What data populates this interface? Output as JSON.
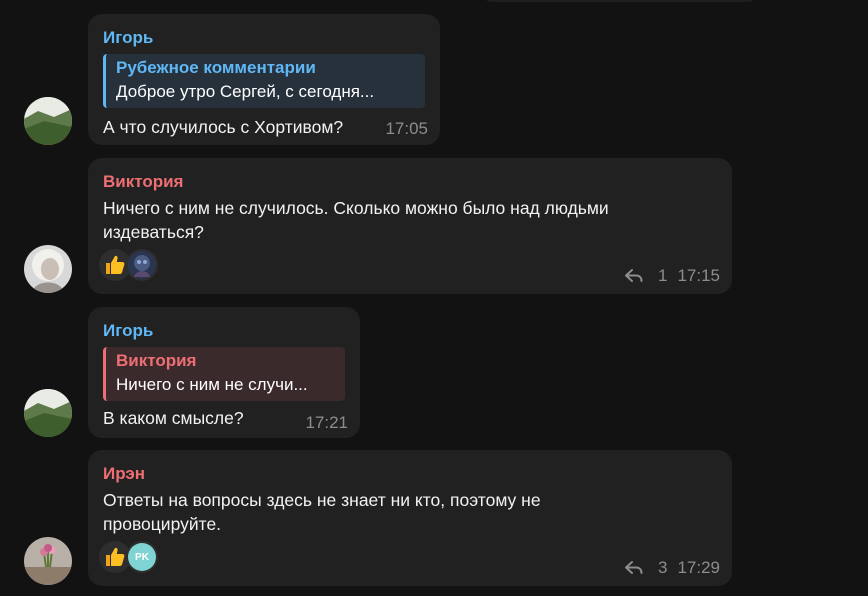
{
  "colors": {
    "background": "#121212",
    "bubble": "#212121",
    "name_blue": "#5fb8f5",
    "name_red": "#ee6f73",
    "meta": "#8d8d8d"
  },
  "messages": [
    {
      "sender": "Игорь",
      "reply": {
        "name": "Рубежное комментарии",
        "text": "Доброе утро Сергей, с сегодня..."
      },
      "text": "А что случилось с Хортивом?",
      "time": "17:05"
    },
    {
      "sender": "Виктория",
      "text_lines": [
        "Ничего с ним не случилось. Сколько можно было над людьми",
        "издеваться?"
      ],
      "reactions": [
        "thumbs-up-emoji",
        "reactor-avatar"
      ],
      "reply_count": "1",
      "time": "17:15"
    },
    {
      "sender": "Игорь",
      "reply": {
        "name": "Виктория",
        "text": "Ничего с ним не случи..."
      },
      "text": "В каком смысле?",
      "time": "17:21"
    },
    {
      "sender": "Ирэн",
      "text_lines": [
        "Ответы на вопросы здесь не знает ни кто, поэтому не",
        "провоцируйте."
      ],
      "reactions": [
        "thumbs-up-emoji",
        "reactor-initials"
      ],
      "reactor_initials": "PK",
      "reply_count": "3",
      "time": "17:29"
    }
  ]
}
